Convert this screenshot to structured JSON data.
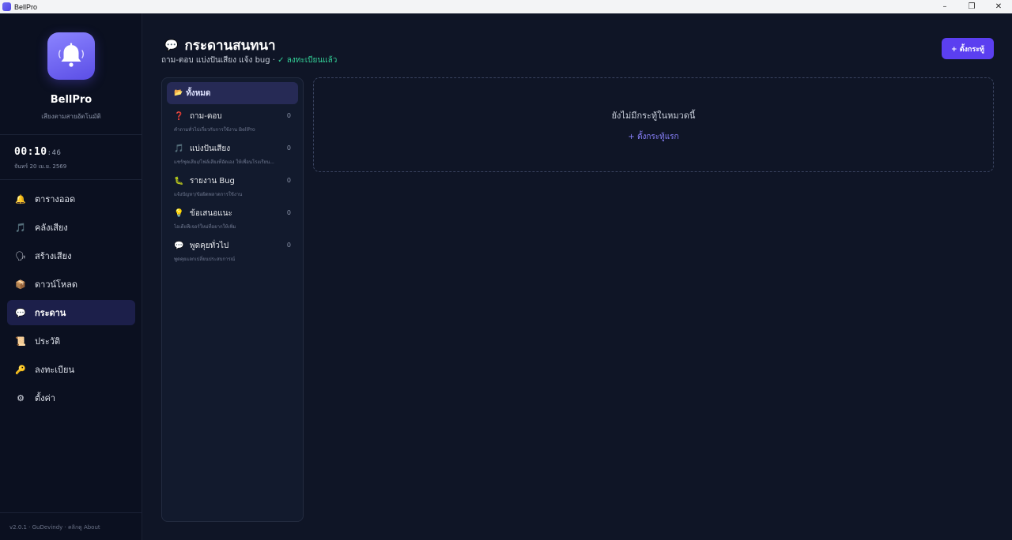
{
  "window": {
    "title": "BellPro",
    "controls": [
      "–",
      "❐",
      "✕"
    ]
  },
  "sidebar": {
    "brand_name": "BellPro",
    "brand_sub": "เสียงตามสายอัตโนมัติ",
    "clock": {
      "hm": "00:10",
      "sec": ":46"
    },
    "date": "จันทร์ 20 เม.ย. 2569",
    "items": [
      {
        "label": "ตารางออด",
        "icon": "bell-icon",
        "glyph": "🔔"
      },
      {
        "label": "คลังเสียง",
        "icon": "music-note-icon",
        "glyph": "🎵"
      },
      {
        "label": "สร้างเสียง",
        "icon": "voice-icon",
        "glyph": "🗣"
      },
      {
        "label": "ดาวน์โหลด",
        "icon": "package-icon",
        "glyph": "📦"
      },
      {
        "label": "กระดาน",
        "icon": "speech-bubble-icon",
        "glyph": "💬",
        "active": true
      },
      {
        "label": "ประวัติ",
        "icon": "scroll-icon",
        "glyph": "📜"
      },
      {
        "label": "ลงทะเบียน",
        "icon": "key-icon",
        "glyph": "🔑"
      },
      {
        "label": "ตั้งค่า",
        "icon": "gear-icon",
        "glyph": "⚙"
      }
    ],
    "version": "v2.0.1 · GuDevindy · คลิกดู About"
  },
  "main": {
    "title": "กระดานสนทนา",
    "subtitle": "ถาม-ตอบ แบ่งปันเสียง แจ้ง bug ·",
    "status": "✓ ลงทะเบียนแล้ว",
    "new_button": "+ ตั้งกระทู้",
    "categories": {
      "all_label": "ทั้งหมด",
      "all_glyph": "📂",
      "items": [
        {
          "glyph": "❓",
          "icon": "question-icon",
          "label": "ถาม-ตอบ",
          "count": "0",
          "desc": "คำถามทั่วไปเกี่ยวกับการใช้งาน BellPro"
        },
        {
          "glyph": "🎵",
          "icon": "music-note-icon",
          "label": "แบ่งปันเสียง",
          "count": "0",
          "desc": "แชร์ชุดเสียง/ไฟล์เสียงที่อัดเอง ให้เพื่อนโรงเรียน..."
        },
        {
          "glyph": "🐛",
          "icon": "bug-icon",
          "label": "รายงาน Bug",
          "count": "0",
          "desc": "แจ้งปัญหา/ข้อผิดพลาดการใช้งาน"
        },
        {
          "glyph": "💡",
          "icon": "lightbulb-icon",
          "label": "ข้อเสนอแนะ",
          "count": "0",
          "desc": "ไอเดียฟีเจอร์ใหม่ที่อยากให้เพิ่ม"
        },
        {
          "glyph": "💬",
          "icon": "speech-bubble-icon",
          "label": "พูดคุยทั่วไป",
          "count": "0",
          "desc": "พูดคุยแลกเปลี่ยนประสบการณ์"
        }
      ]
    },
    "empty": {
      "title": "ยังไม่มีกระทู้ในหมวดนี้",
      "link": "+ ตั้งกระทู้แรก"
    }
  },
  "colors": {
    "accent": "#5b3ff0",
    "active_nav": "#1c1f4a",
    "success": "#34d399",
    "link": "#8b83ff"
  }
}
